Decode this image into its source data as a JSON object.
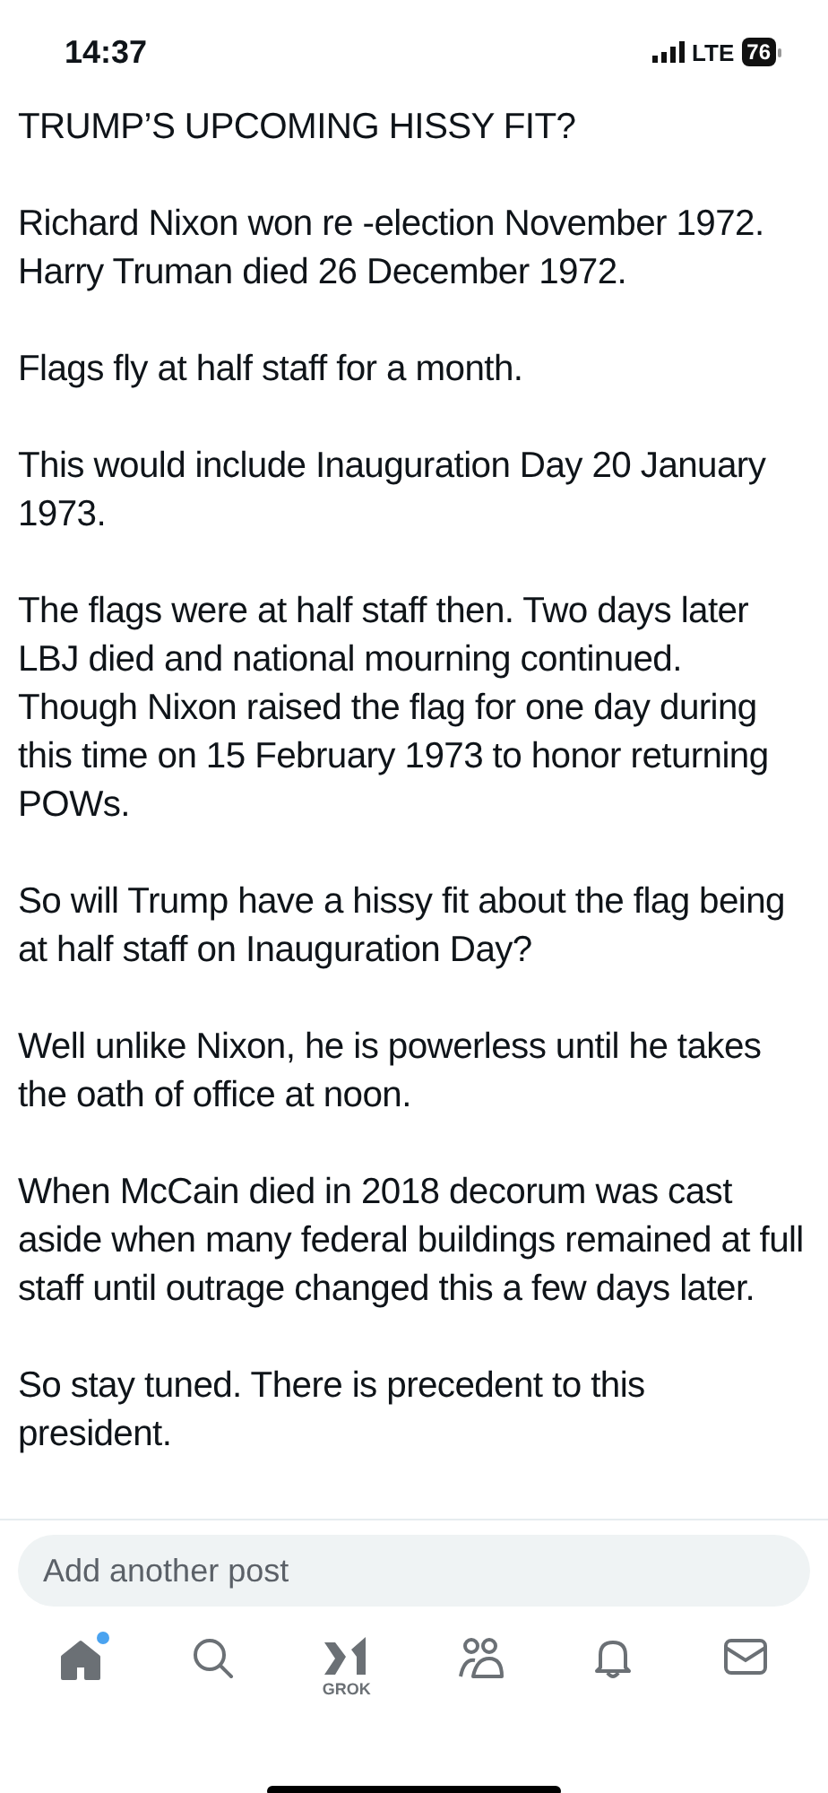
{
  "status_bar": {
    "time": "14:37",
    "network": "LTE",
    "battery": "76"
  },
  "post": {
    "paragraphs": [
      "TRUMP’S UPCOMING HISSY FIT?",
      "Richard Nixon won re -election November 1972. Harry Truman died 26 December 1972.",
      "Flags fly at half staff for a month.",
      "This would include Inauguration Day 20 January 1973.",
      "The flags were at half staff then. Two days later LBJ died and national mourning continued. Though Nixon raised the flag for one day during this time on 15 February 1973 to honor returning POWs.",
      "So will Trump have a hissy fit about the flag being at half staff on Inauguration Day?",
      "Well unlike Nixon, he is powerless until he takes the oath of office at noon.",
      "When McCain died in 2018 decorum was cast aside when many federal buildings remained at full staff until outrage changed this a few days later.",
      "So stay tuned. There is precedent to this president."
    ]
  },
  "composer": {
    "placeholder": "Add another post"
  },
  "tabs": [
    {
      "kind": "home",
      "selected": true,
      "badge": true
    },
    {
      "kind": "search",
      "selected": false,
      "badge": false
    },
    {
      "kind": "grok",
      "label": "GROK",
      "selected": false,
      "badge": false
    },
    {
      "kind": "communities",
      "selected": false,
      "badge": false
    },
    {
      "kind": "notifications",
      "selected": false,
      "badge": false
    },
    {
      "kind": "messages",
      "selected": false,
      "badge": false
    }
  ]
}
